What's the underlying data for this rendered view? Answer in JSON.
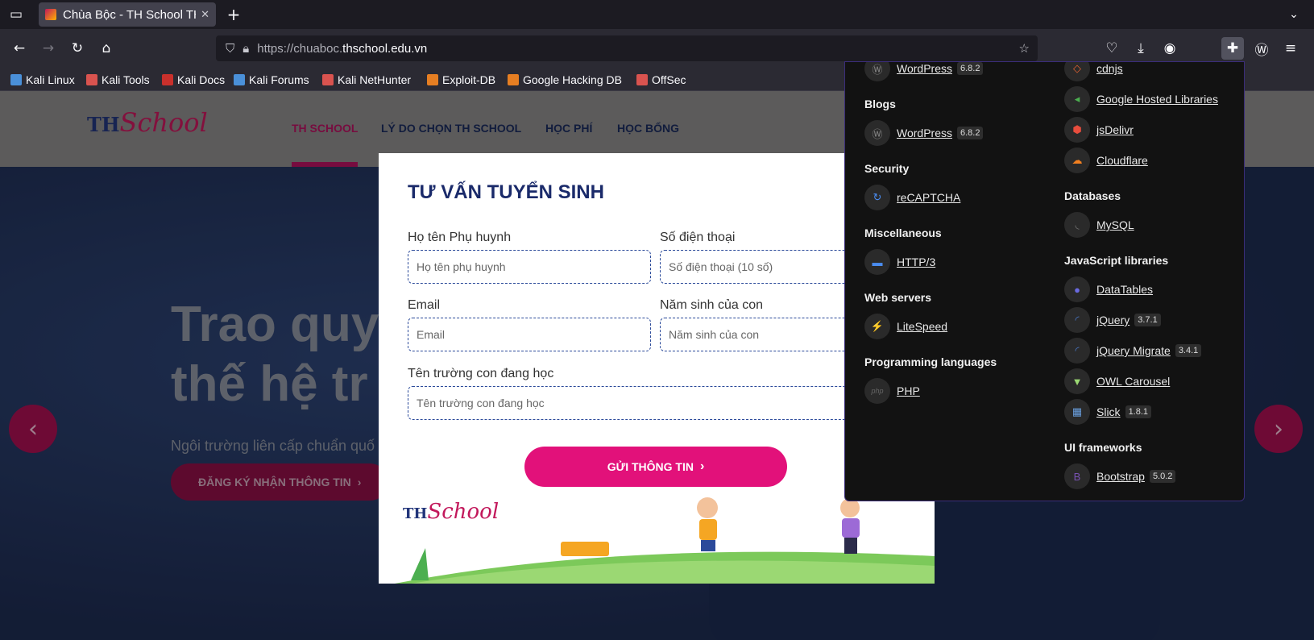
{
  "browser": {
    "tab_title": "Chùa Bộc - TH School TH",
    "tab_close": "✕",
    "new_tab": "+",
    "url_proto": "https://chuaboc.",
    "url_domain": "thschool.edu.vn",
    "bookmarks": [
      {
        "label": "Kali Linux",
        "color": "#4a90d9"
      },
      {
        "label": "Kali Tools",
        "color": "#d9534f"
      },
      {
        "label": "Kali Docs",
        "color": "#c9302c"
      },
      {
        "label": "Kali Forums",
        "color": "#4a90d9"
      },
      {
        "label": "Kali NetHunter",
        "color": "#d9534f"
      },
      {
        "label": "Exploit-DB",
        "color": "#e67e22"
      },
      {
        "label": "Google Hacking DB",
        "color": "#e67e22"
      },
      {
        "label": "OffSec",
        "color": "#d9534f"
      }
    ]
  },
  "site": {
    "logo_th": "TH",
    "logo_school": "School",
    "nav": [
      "TH SCHOOL",
      "LÝ DO CHỌN TH SCHOOL",
      "HỌC PHÍ",
      "HỌC BỔNG"
    ],
    "hero_line1": "Trao quyề",
    "hero_line2": "thế hệ tr",
    "hero_sub": "Ngôi trường liên cấp chuẩn quố",
    "hero_cta": "ĐĂNG KÝ NHẬN THÔNG TIN",
    "accent": "#e2117a"
  },
  "modal": {
    "title": "TƯ VẤN TUYỂN SINH",
    "fields": [
      {
        "label": "Họ tên Phụ huynh",
        "placeholder": "Họ tên phụ huynh"
      },
      {
        "label": "Số điện thoại",
        "placeholder": "Số điện thoại (10 số)"
      },
      {
        "label": "Email",
        "placeholder": "Email"
      },
      {
        "label": "Năm sinh của con",
        "placeholder": "Năm sinh của con"
      },
      {
        "label": "Tên trường con đang học",
        "placeholder": "Tên trường con đang học"
      }
    ],
    "submit": "GỬI THÔNG TIN",
    "logo_th": "TH",
    "logo_school": "School"
  },
  "wappalyzer": {
    "left": [
      {
        "type": "item",
        "name": "WordPress",
        "version": "6.8.2",
        "icon": "wordpress-icon"
      },
      {
        "type": "cat",
        "name": "Blogs"
      },
      {
        "type": "item",
        "name": "WordPress",
        "version": "6.8.2",
        "icon": "wordpress-icon"
      },
      {
        "type": "cat",
        "name": "Security"
      },
      {
        "type": "item",
        "name": "reCAPTCHA",
        "version": "",
        "icon": "recaptcha-icon"
      },
      {
        "type": "cat",
        "name": "Miscellaneous"
      },
      {
        "type": "item",
        "name": "HTTP/3",
        "version": "",
        "icon": "http3-icon"
      },
      {
        "type": "cat",
        "name": "Web servers"
      },
      {
        "type": "item",
        "name": "LiteSpeed",
        "version": "",
        "icon": "litespeed-icon"
      },
      {
        "type": "cat",
        "name": "Programming languages"
      },
      {
        "type": "item",
        "name": "PHP",
        "version": "",
        "icon": "php-icon"
      }
    ],
    "right": [
      {
        "type": "item",
        "name": "cdnjs",
        "version": "",
        "icon": "cdnjs-icon"
      },
      {
        "type": "item",
        "name": "Google Hosted Libraries",
        "version": "",
        "icon": "google-icon"
      },
      {
        "type": "item",
        "name": "jsDelivr",
        "version": "",
        "icon": "jsdelivr-icon"
      },
      {
        "type": "item",
        "name": "Cloudflare",
        "version": "",
        "icon": "cloudflare-icon"
      },
      {
        "type": "cat",
        "name": "Databases"
      },
      {
        "type": "item",
        "name": "MySQL",
        "version": "",
        "icon": "mysql-icon"
      },
      {
        "type": "cat",
        "name": "JavaScript libraries"
      },
      {
        "type": "item",
        "name": "DataTables",
        "version": "",
        "icon": "datatables-icon"
      },
      {
        "type": "item",
        "name": "jQuery",
        "version": "3.7.1",
        "icon": "jquery-icon"
      },
      {
        "type": "item",
        "name": "jQuery Migrate",
        "version": "3.4.1",
        "icon": "jquery-icon"
      },
      {
        "type": "item",
        "name": "OWL Carousel",
        "version": "",
        "icon": "owl-icon"
      },
      {
        "type": "item",
        "name": "Slick",
        "version": "1.8.1",
        "icon": "slick-icon"
      },
      {
        "type": "cat",
        "name": "UI frameworks"
      },
      {
        "type": "item",
        "name": "Bootstrap",
        "version": "5.0.2",
        "icon": "bootstrap-icon"
      }
    ]
  }
}
